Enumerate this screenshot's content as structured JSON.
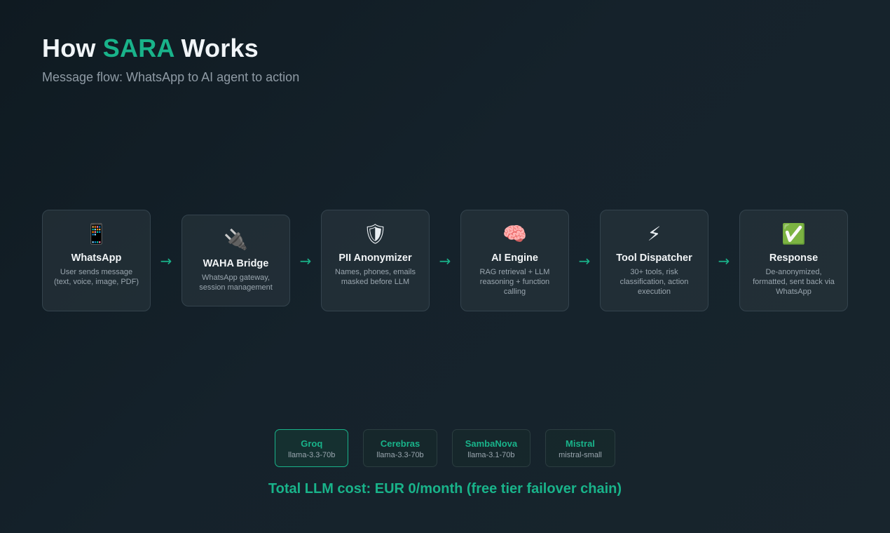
{
  "header": {
    "title_prefix": "How ",
    "title_accent": "SARA",
    "title_suffix": " Works",
    "subtitle": "Message flow: WhatsApp to AI agent to action"
  },
  "colors": {
    "accent": "#19b38a",
    "background": "#131f27",
    "card": "#232f37"
  },
  "flow": [
    {
      "icon_name": "mobile-phone-icon",
      "icon": "📱",
      "name": "WhatsApp",
      "desc": "User sends message (text, voice, image, PDF)"
    },
    {
      "icon_name": "plug-icon",
      "icon": "🔌",
      "name": "WAHA Bridge",
      "desc": "WhatsApp gateway, session management"
    },
    {
      "icon_name": "shield-icon",
      "icon": "🛡",
      "name": "PII Anonymizer",
      "desc": "Names, phones, emails masked before LLM"
    },
    {
      "icon_name": "brain-icon",
      "icon": "🧠",
      "name": "AI Engine",
      "desc": "RAG retrieval + LLM reasoning + function calling"
    },
    {
      "icon_name": "lightning-icon",
      "icon": "⚡",
      "name": "Tool Dispatcher",
      "desc": "30+ tools, risk classification, action execution"
    },
    {
      "icon_name": "check-mark-icon",
      "icon": "✅",
      "name": "Response",
      "desc": "De-anonymized, formatted, sent back via WhatsApp"
    }
  ],
  "arrow_glyph": "→",
  "providers": [
    {
      "name": "Groq",
      "model": "llama-3.3-70b"
    },
    {
      "name": "Cerebras",
      "model": "llama-3.3-70b"
    },
    {
      "name": "SambaNova",
      "model": "llama-3.1-70b"
    },
    {
      "name": "Mistral",
      "model": "mistral-small"
    }
  ],
  "active_provider": "Groq",
  "footer": {
    "cost": "Total LLM cost: EUR 0/month (free tier failover chain)"
  }
}
